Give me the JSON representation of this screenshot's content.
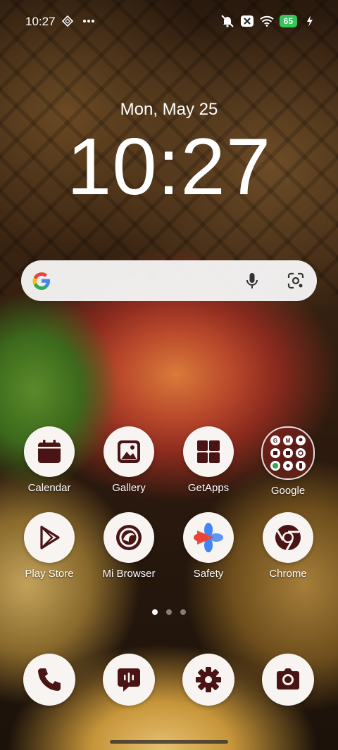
{
  "status_bar": {
    "time": "10:27",
    "battery": "65",
    "icons": [
      "vpn-icon",
      "more-dots-icon",
      "mute-icon",
      "x-box-icon",
      "wifi-icon",
      "charging-icon"
    ]
  },
  "lockscreen": {
    "date": "Mon, May 25",
    "clock": "10:27"
  },
  "search_bar": {
    "icons": [
      "google-g-icon",
      "mic-icon",
      "lens-icon"
    ]
  },
  "apps": [
    {
      "label": "Calendar",
      "icon": "calendar-icon"
    },
    {
      "label": "Gallery",
      "icon": "gallery-icon"
    },
    {
      "label": "GetApps",
      "icon": "getapps-icon"
    },
    {
      "label": "Google",
      "icon": "google-folder-icon"
    },
    {
      "label": "Play Store",
      "icon": "play-store-icon"
    },
    {
      "label": "Mi Browser",
      "icon": "mi-browser-icon"
    },
    {
      "label": "Safety",
      "icon": "safety-icon"
    },
    {
      "label": "Chrome",
      "icon": "chrome-icon"
    }
  ],
  "page_indicator": {
    "pages": 3,
    "active": 1
  },
  "dock": [
    {
      "icon": "phone-icon"
    },
    {
      "icon": "messages-icon"
    },
    {
      "icon": "settings-icon"
    },
    {
      "icon": "camera-icon"
    }
  ],
  "colors": {
    "icon_fill": "#4a1414",
    "icon_bg": "#f8f4f2",
    "battery": "#34c759"
  }
}
